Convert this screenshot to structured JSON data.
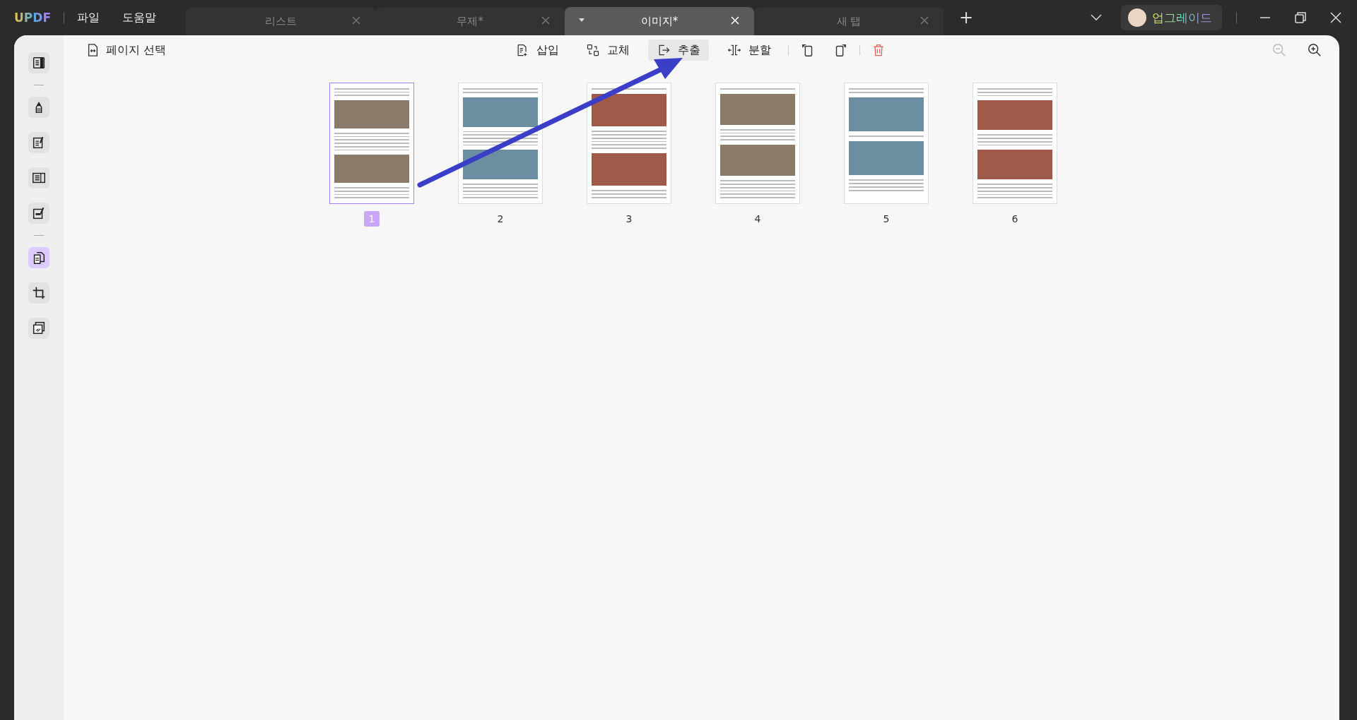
{
  "app": {
    "logo": "UPDF",
    "menu": [
      "파일",
      "도움말"
    ]
  },
  "tabs": [
    {
      "label": "리스트",
      "selected": false
    },
    {
      "label": "무제*",
      "selected": false
    },
    {
      "label": "이미지*",
      "selected": true
    },
    {
      "label": "새 탭",
      "selected": false
    }
  ],
  "new_tab": "+",
  "upgrade": "업그레이드",
  "sidebar": {
    "groups": [
      [
        {
          "selected": false
        }
      ],
      [
        {
          "selected": false
        },
        {
          "selected": false
        },
        {
          "selected": false
        },
        {
          "selected": false
        }
      ],
      [
        {
          "selected": true
        },
        {
          "selected": false
        },
        {
          "selected": false
        }
      ]
    ]
  },
  "toolbar": {
    "page_select": "페이지 선택",
    "actions": [
      {
        "label": "삽입",
        "selected": false
      },
      {
        "label": "교체",
        "selected": false
      },
      {
        "label": "추출",
        "selected": true
      },
      {
        "label": "분할",
        "selected": false
      }
    ],
    "zoom_out": {
      "disabled": true
    }
  },
  "pages": [
    {
      "label": "1",
      "selected": true
    },
    {
      "label": "2",
      "selected": false
    },
    {
      "label": "3",
      "selected": false
    },
    {
      "label": "4",
      "selected": false
    },
    {
      "label": "5",
      "selected": false
    },
    {
      "label": "6",
      "selected": false
    }
  ]
}
